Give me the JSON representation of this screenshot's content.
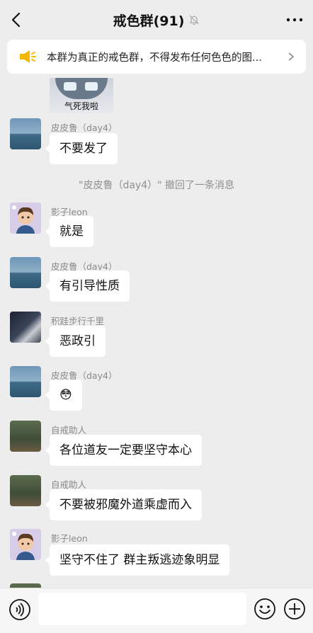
{
  "header": {
    "title": "戒色群(91)",
    "back_icon": "chevron-left-icon",
    "mute_icon": "bell-off-icon",
    "more_icon": "more-dots-icon"
  },
  "notice": {
    "icon": "megaphone-icon",
    "text": "本群为真正的戒色群，不得发布任何色色的图...",
    "arrow_icon": "chevron-right-icon",
    "accent_color": "#f5b800"
  },
  "sticker": {
    "caption": "气死我啦"
  },
  "messages": [
    {
      "sender": "皮皮鲁（day4）",
      "text": "不要发了",
      "avatar": "sea"
    },
    {
      "sender": "影子leon",
      "text": "就是",
      "avatar": "cartoon"
    },
    {
      "sender": "皮皮鲁（day4）",
      "text": "有引导性质",
      "avatar": "sea"
    },
    {
      "sender": "积跬步行千里",
      "text": "恶政引",
      "avatar": "dark"
    },
    {
      "sender": "皮皮鲁（day4）",
      "text": "😳",
      "avatar": "sea"
    },
    {
      "sender": "自戒助人",
      "text": "各位道友一定要坚守本心",
      "avatar": "forest"
    },
    {
      "sender": "自戒助人",
      "text": "不要被邪魔外道乘虚而入",
      "avatar": "forest"
    },
    {
      "sender": "影子leon",
      "text": "坚守不住了 群主叛逃迹象明显",
      "avatar": "cartoon"
    }
  ],
  "system_message": "\"皮皮鲁（day4）\" 撤回了一条消息",
  "inputbar": {
    "voice_icon": "voice-icon",
    "emoji_icon": "emoji-icon",
    "plus_icon": "plus-circle-icon",
    "placeholder": ""
  }
}
